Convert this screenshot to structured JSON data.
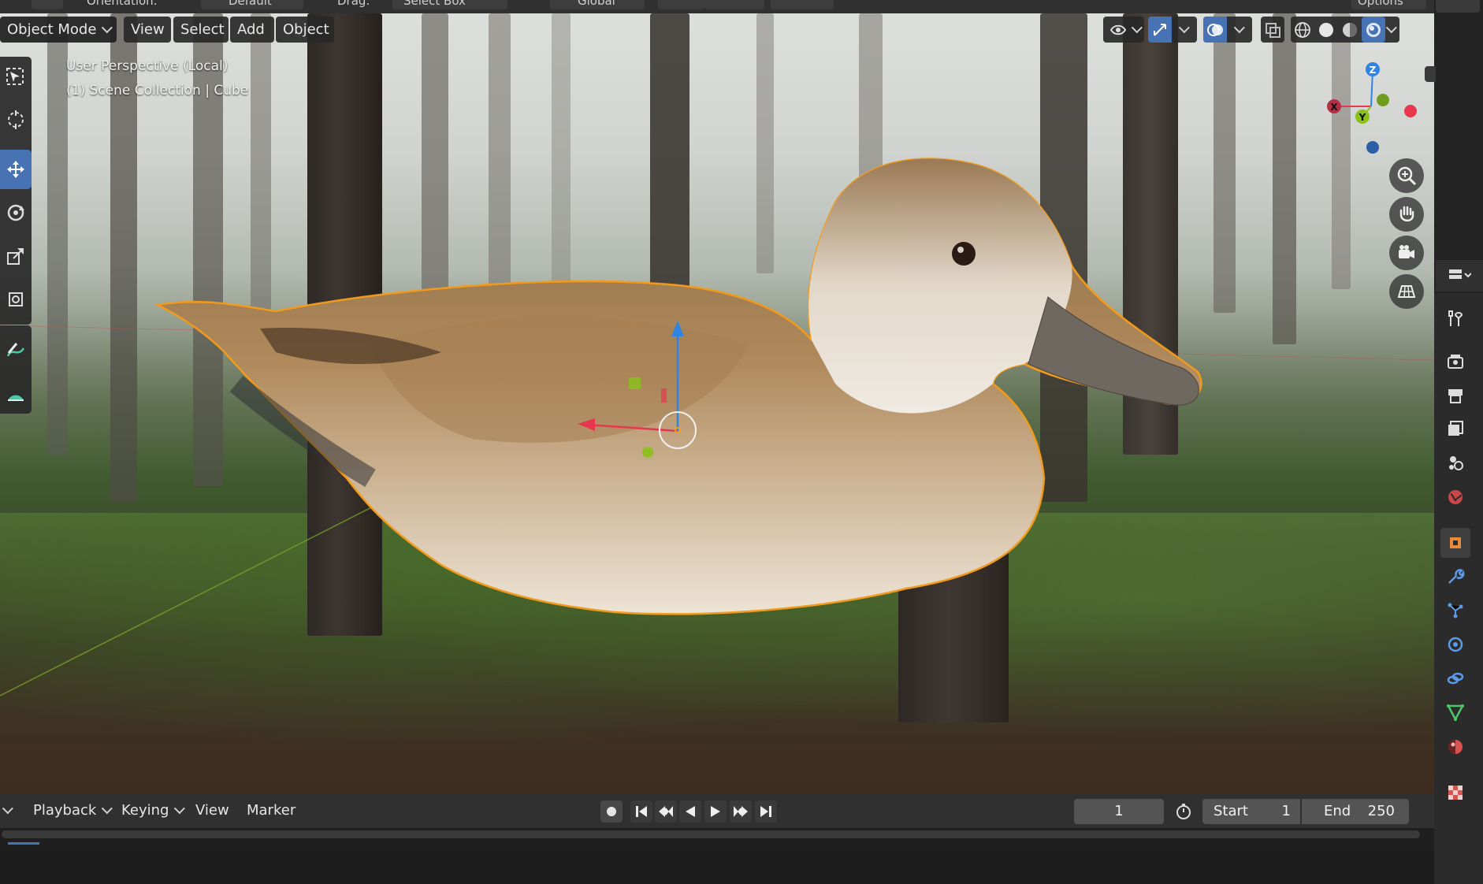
{
  "topbar": {
    "orientation_label": "Orientation:",
    "orientation_value": "Default",
    "drag_label": "Drag:",
    "drag_value": "Select Box",
    "transform_space": "Global",
    "options_label": "Options"
  },
  "viewport_header": {
    "mode": "Object Mode",
    "menu": [
      "View",
      "Select",
      "Add",
      "Object"
    ]
  },
  "overlay": {
    "perspective": "User Perspective (Local)",
    "collection": "(1) Scene Collection | Cube"
  },
  "toolbar": {
    "tools": [
      "select-box-icon",
      "cursor-icon",
      "move-icon",
      "rotate-icon",
      "scale-icon",
      "transform-icon",
      "annotate-icon",
      "measure-icon"
    ],
    "active_tool": "move-icon"
  },
  "shading": {
    "modes": [
      "wireframe-icon",
      "solid-icon",
      "material-preview-icon",
      "rendered-icon"
    ],
    "active_mode": "rendered-icon"
  },
  "gizmo": {
    "axes": {
      "x": "X",
      "y": "Y",
      "z": "Z"
    },
    "colors": {
      "x": "#e8364f",
      "y": "#8ac11b",
      "z": "#2f83e3"
    }
  },
  "nav_buttons": [
    "zoom-icon",
    "hand-pan-icon",
    "camera-icon",
    "grid-ortho-icon"
  ],
  "properties_tabs": [
    "tool-icon",
    "render-icon",
    "output-icon",
    "view-layer-icon",
    "scene-icon",
    "world-icon",
    "object-icon",
    "modifier-icon",
    "particles-icon",
    "physics-icon",
    "constraints-icon",
    "data-icon",
    "material-icon",
    "texture-icon"
  ],
  "timeline": {
    "menu": [
      "Playback",
      "Keying",
      "View",
      "Marker"
    ],
    "current_frame": "1",
    "start_label": "Start",
    "start_value": "1",
    "end_label": "End",
    "end_value": "250"
  },
  "colors": {
    "accent": "#4772b3",
    "selection_outline": "#f29a1c",
    "panel": "#303030"
  }
}
